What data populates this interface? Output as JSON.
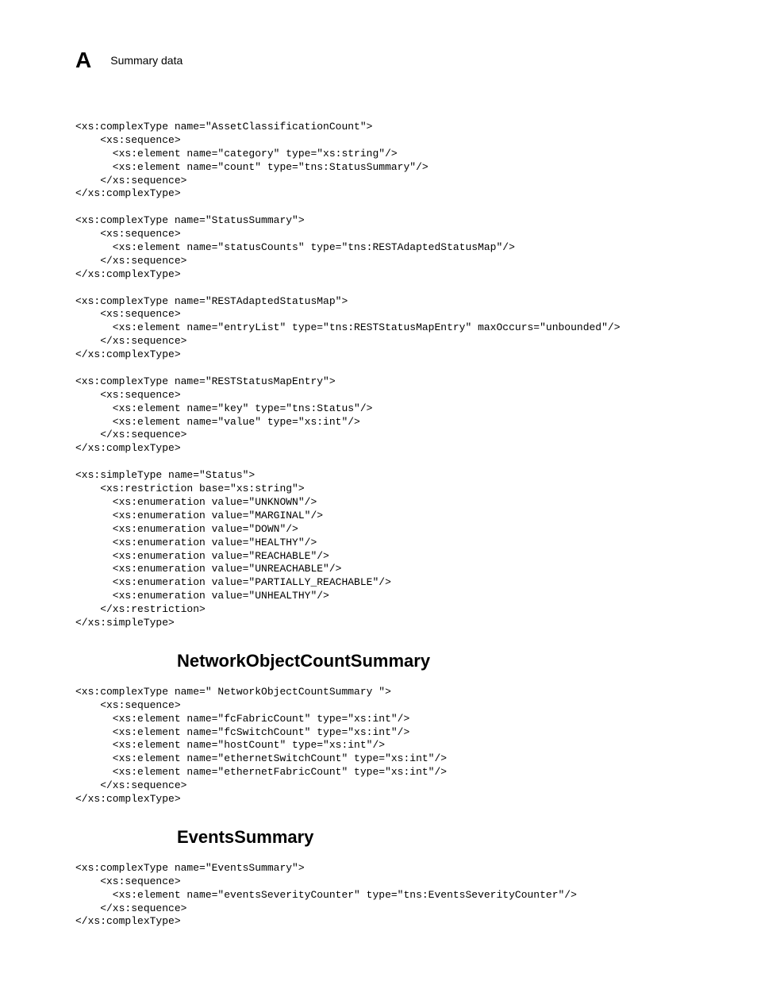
{
  "header": {
    "appendix_letter": "A",
    "title": "Summary data"
  },
  "code_block_1": "<xs:complexType name=\"AssetClassificationCount\">\n    <xs:sequence>\n      <xs:element name=\"category\" type=\"xs:string\"/>\n      <xs:element name=\"count\" type=\"tns:StatusSummary\"/>\n    </xs:sequence>\n</xs:complexType>\n\n<xs:complexType name=\"StatusSummary\">\n    <xs:sequence>\n      <xs:element name=\"statusCounts\" type=\"tns:RESTAdaptedStatusMap\"/>\n    </xs:sequence>\n</xs:complexType>\n\n<xs:complexType name=\"RESTAdaptedStatusMap\">\n    <xs:sequence>\n      <xs:element name=\"entryList\" type=\"tns:RESTStatusMapEntry\" maxOccurs=\"unbounded\"/>\n    </xs:sequence>\n</xs:complexType>\n\n<xs:complexType name=\"RESTStatusMapEntry\">\n    <xs:sequence>\n      <xs:element name=\"key\" type=\"tns:Status\"/>\n      <xs:element name=\"value\" type=\"xs:int\"/>\n    </xs:sequence>\n</xs:complexType>\n\n<xs:simpleType name=\"Status\">\n    <xs:restriction base=\"xs:string\">\n      <xs:enumeration value=\"UNKNOWN\"/>\n      <xs:enumeration value=\"MARGINAL\"/>\n      <xs:enumeration value=\"DOWN\"/>\n      <xs:enumeration value=\"HEALTHY\"/>\n      <xs:enumeration value=\"REACHABLE\"/>\n      <xs:enumeration value=\"UNREACHABLE\"/>\n      <xs:enumeration value=\"PARTIALLY_REACHABLE\"/>\n      <xs:enumeration value=\"UNHEALTHY\"/>\n    </xs:restriction>\n</xs:simpleType>",
  "heading_1": "NetworkObjectCountSummary",
  "code_block_2": "<xs:complexType name=\" NetworkObjectCountSummary \">\n    <xs:sequence>\n      <xs:element name=\"fcFabricCount\" type=\"xs:int\"/>\n      <xs:element name=\"fcSwitchCount\" type=\"xs:int\"/>\n      <xs:element name=\"hostCount\" type=\"xs:int\"/>\n      <xs:element name=\"ethernetSwitchCount\" type=\"xs:int\"/>\n      <xs:element name=\"ethernetFabricCount\" type=\"xs:int\"/>\n    </xs:sequence>\n</xs:complexType>",
  "heading_2": "EventsSummary",
  "code_block_3": "<xs:complexType name=\"EventsSummary\">\n    <xs:sequence>\n      <xs:element name=\"eventsSeverityCounter\" type=\"tns:EventsSeverityCounter\"/>\n    </xs:sequence>\n</xs:complexType>"
}
